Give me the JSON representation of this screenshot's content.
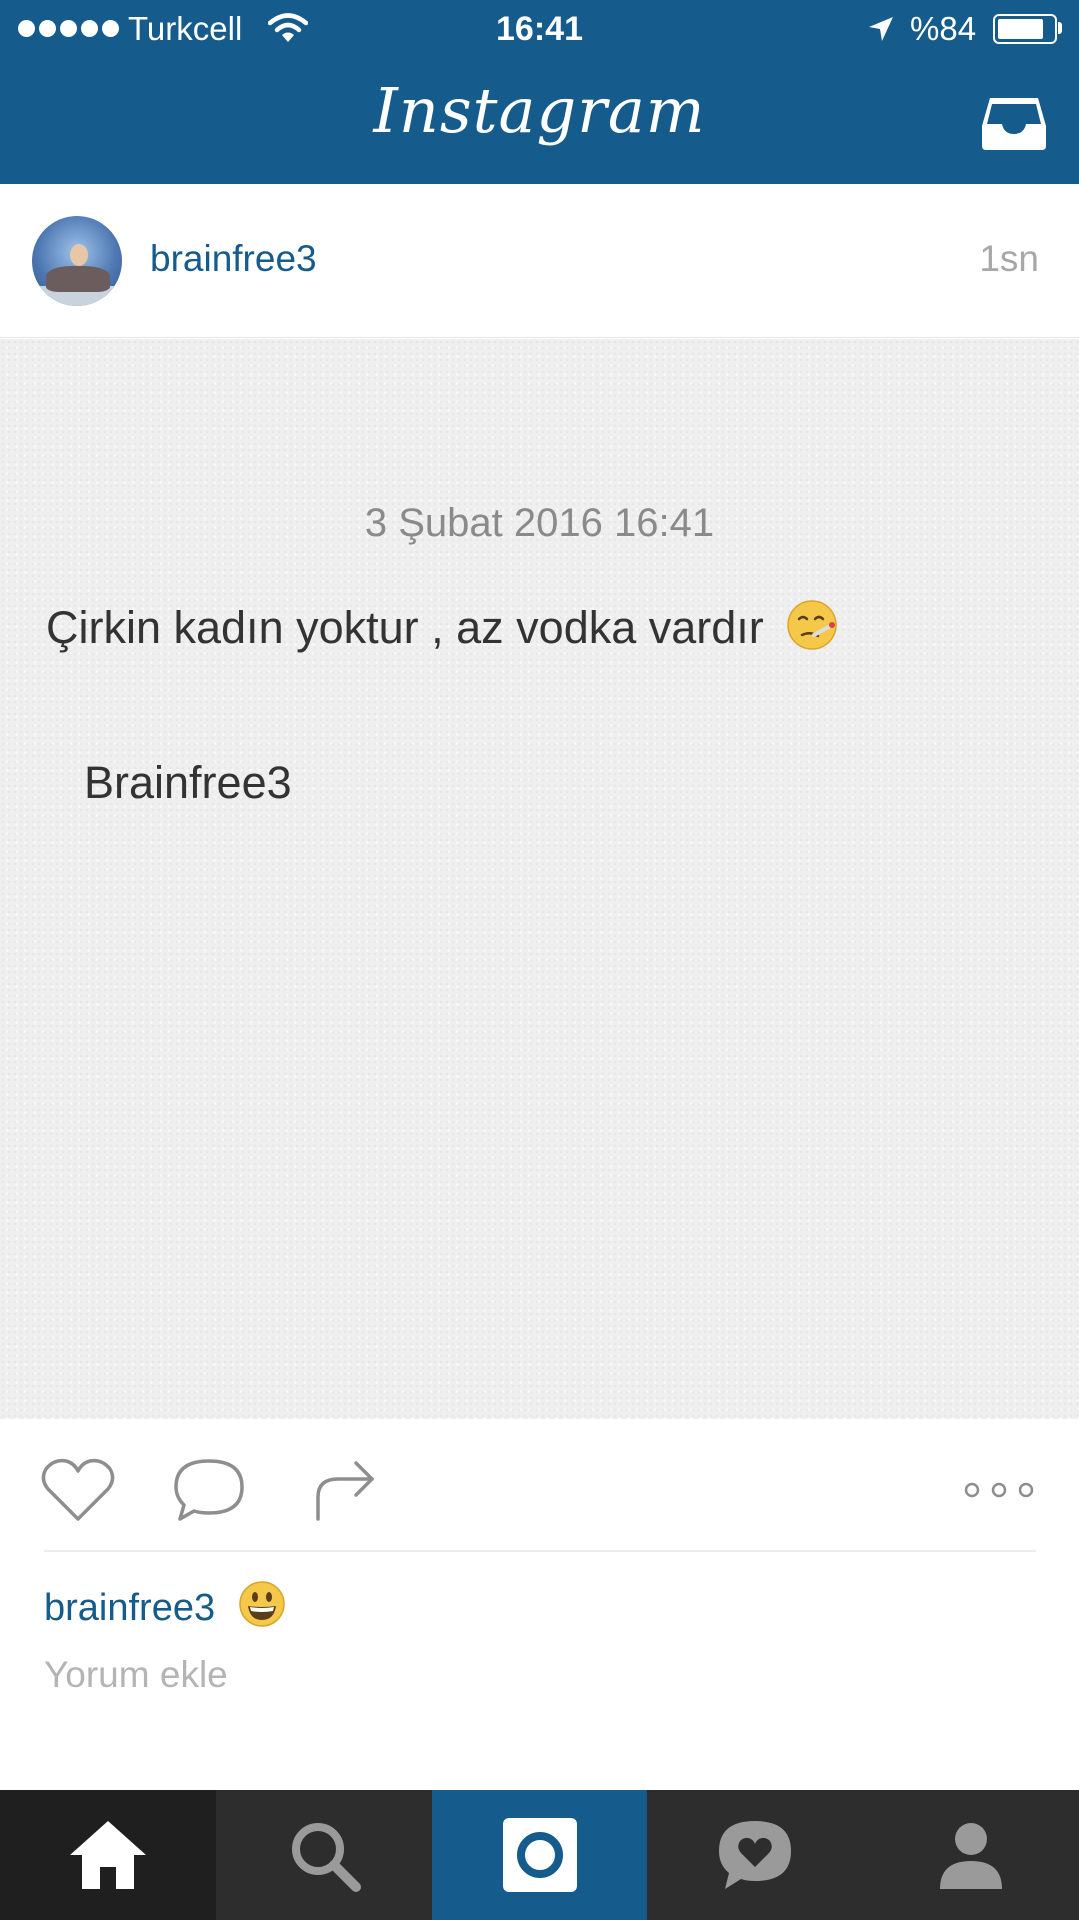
{
  "status_bar": {
    "carrier": "Turkcell",
    "time": "16:41",
    "battery_percent": "%84",
    "battery_level": 0.84
  },
  "header": {
    "app_title": "Instagram",
    "inbox_icon": "inbox-tray-icon"
  },
  "post": {
    "username": "brainfree3",
    "time_ago": "1sn",
    "photo_text": {
      "date": "3 Şubat 2016 16:41",
      "quote": "Çirkin kadın yoktur , az vodka vardır",
      "quote_emoji": "sick-thermometer-face-emoji",
      "signature": "Brainfree3"
    },
    "actions": {
      "like_icon": "heart-icon",
      "comment_icon": "speech-bubble-icon",
      "share_icon": "share-arrow-icon",
      "more_icon": "more-dots-icon"
    },
    "caption": {
      "username": "brainfree3",
      "emoji": "grinning-face-emoji"
    },
    "add_comment_placeholder": "Yorum ekle"
  },
  "tab_bar": [
    {
      "name": "home",
      "icon": "home-icon",
      "active": true
    },
    {
      "name": "search",
      "icon": "search-icon",
      "active": false
    },
    {
      "name": "camera",
      "icon": "camera-icon",
      "active": false
    },
    {
      "name": "activity",
      "icon": "heart-bubble-icon",
      "active": false
    },
    {
      "name": "profile",
      "icon": "profile-icon",
      "active": false
    }
  ],
  "colors": {
    "brand_blue": "#155b8c",
    "tab_bar_bg": "#2d2d2d",
    "muted_text": "#a7a7a7"
  }
}
